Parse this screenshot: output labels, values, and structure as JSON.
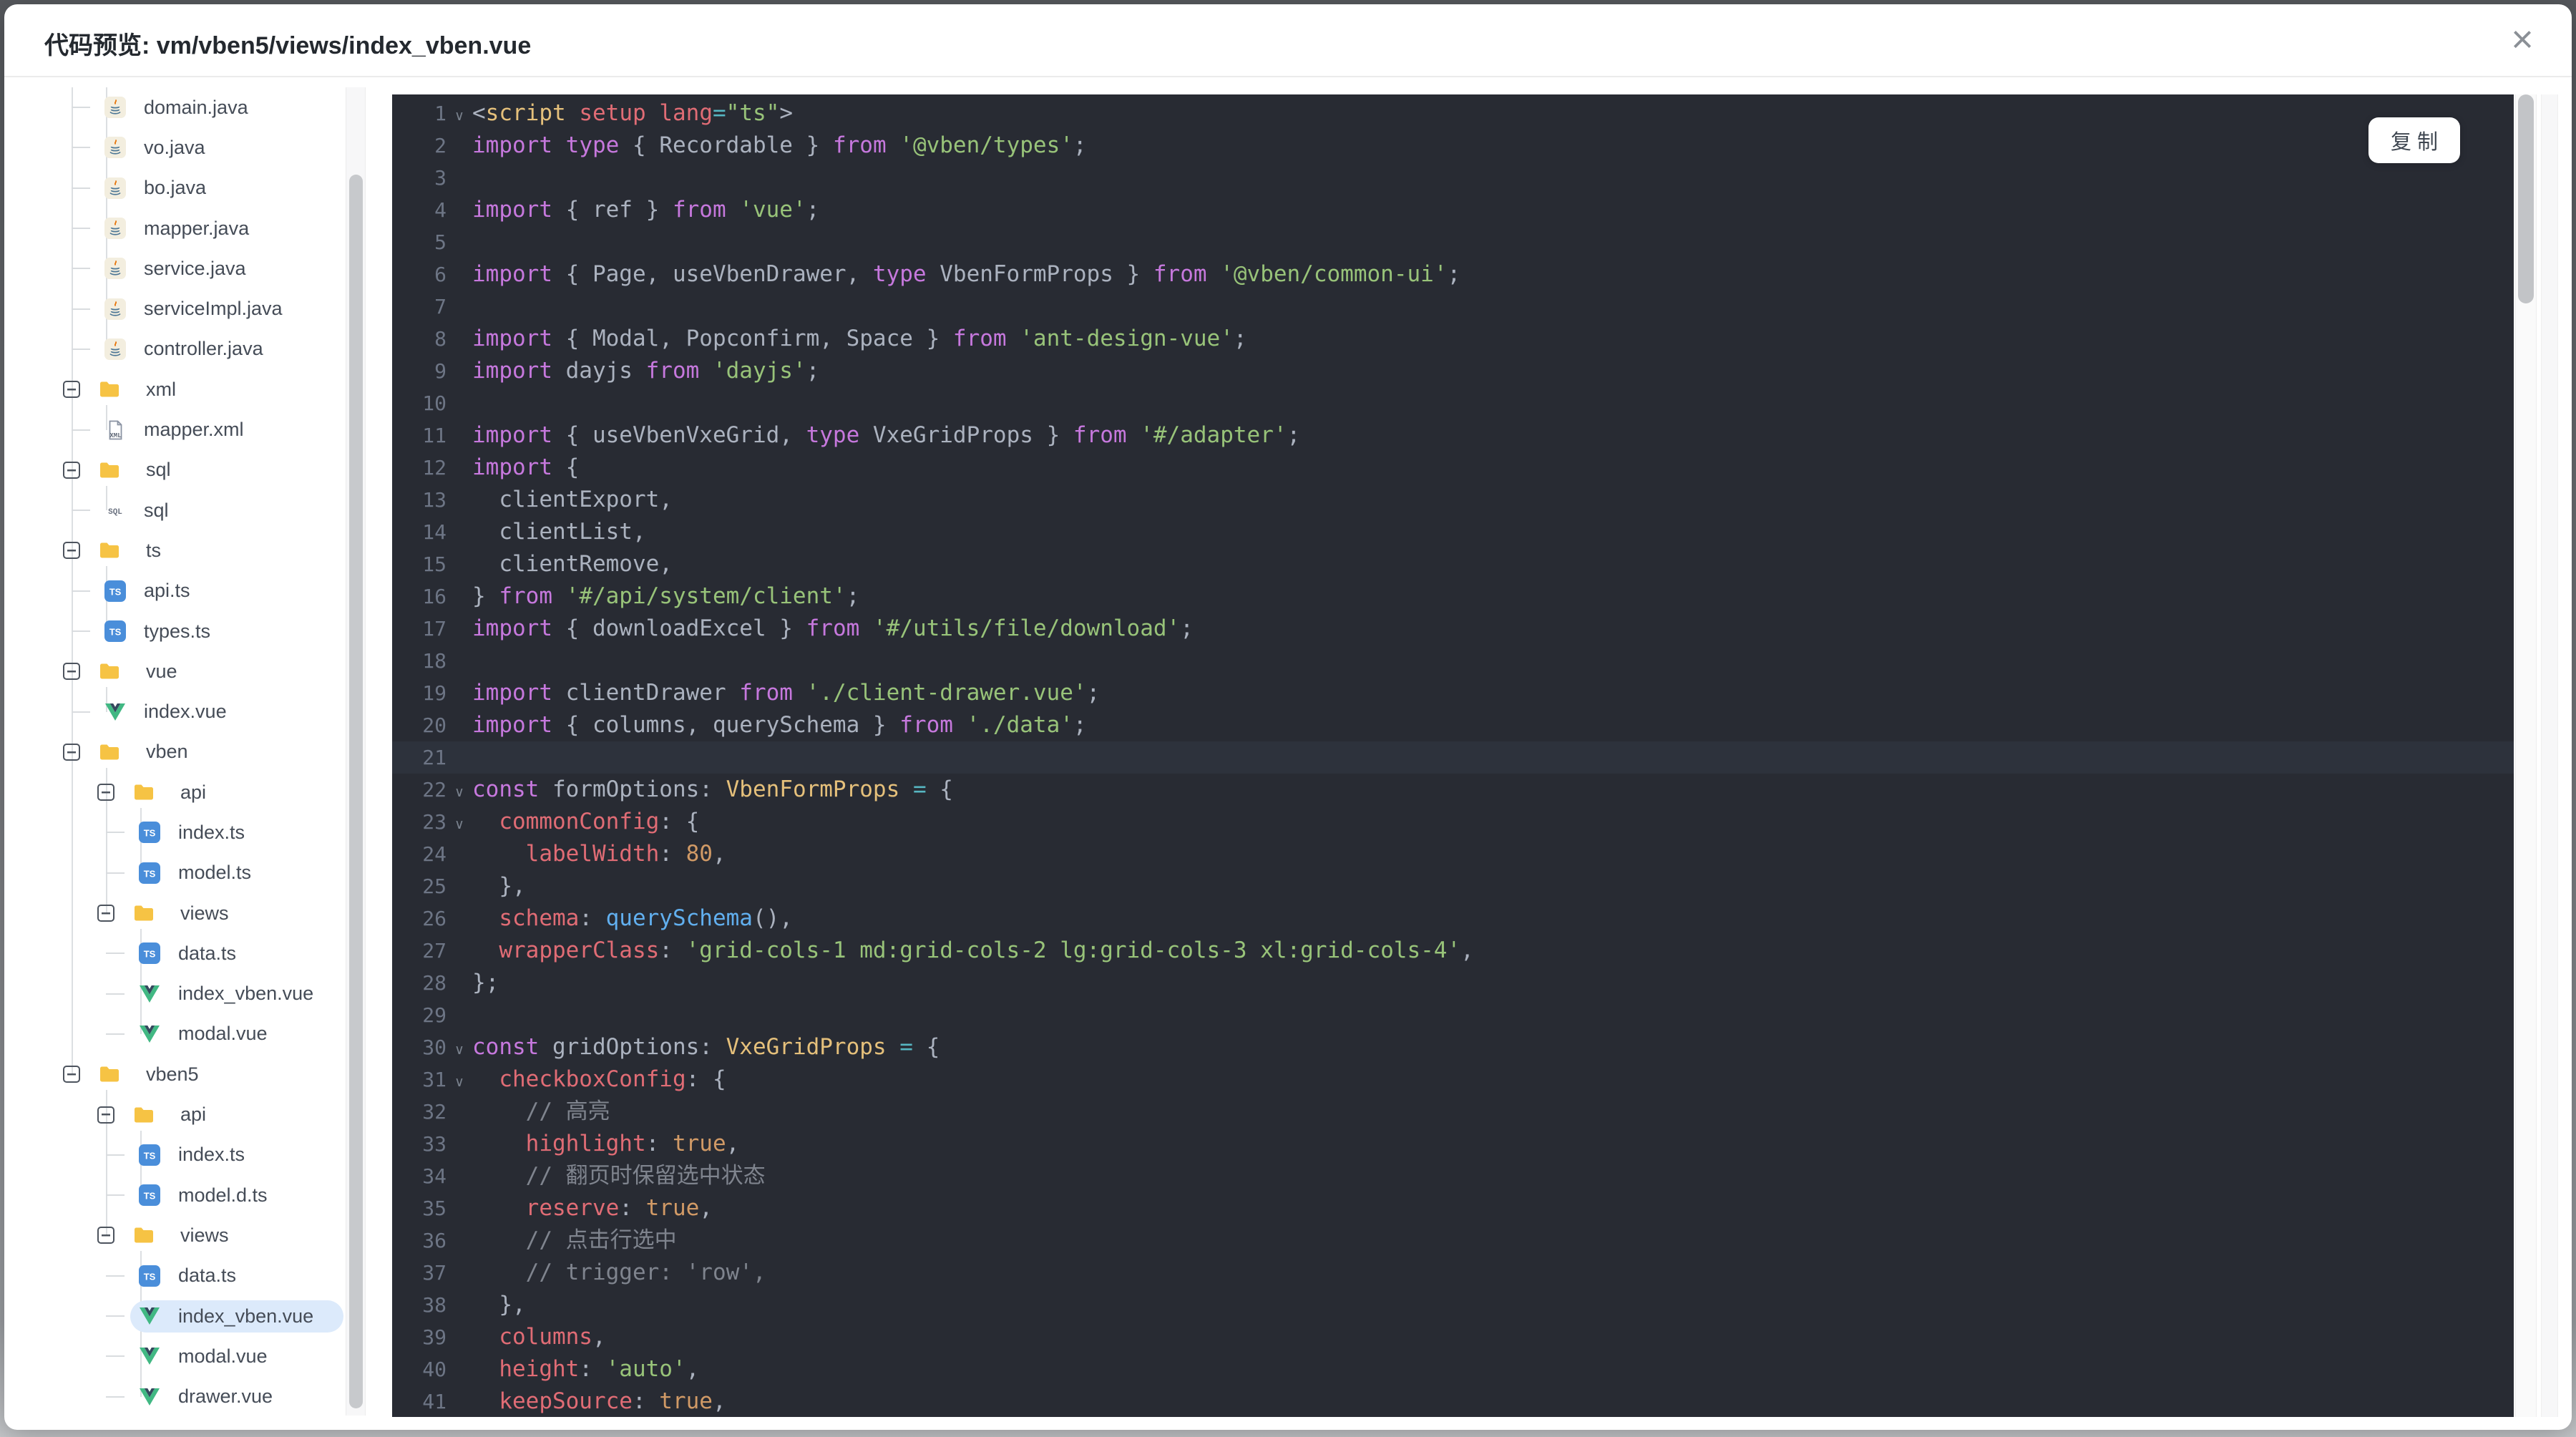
{
  "dialog": {
    "title": "代码预览: vm/vben5/views/index_vben.vue"
  },
  "icons": {
    "close": "×",
    "fold": "∨"
  },
  "colors": {
    "code_bg": "#282b33",
    "active_line": "#2d323c",
    "selected_item_bg": "#dceafb",
    "folder": "#F6C344",
    "ts_badge": "#4A8EDA",
    "vue_green": "#41B883",
    "vue_navy": "#35495E",
    "keyword": "#c678dd",
    "string": "#98c379",
    "property": "#e06c75",
    "type": "#e5c07b",
    "number": "#d19a66",
    "function": "#61afef",
    "operator": "#56b6c2",
    "comment": "#7f848e"
  },
  "code_viewer": {
    "copy_button": "复 制"
  },
  "file_tree": {
    "items": [
      {
        "label": "domain.java",
        "type": "java",
        "level": 2
      },
      {
        "label": "vo.java",
        "type": "java",
        "level": 2
      },
      {
        "label": "bo.java",
        "type": "java",
        "level": 2
      },
      {
        "label": "mapper.java",
        "type": "java",
        "level": 2
      },
      {
        "label": "service.java",
        "type": "java",
        "level": 2
      },
      {
        "label": "serviceImpl.java",
        "type": "java",
        "level": 2
      },
      {
        "label": "controller.java",
        "type": "java",
        "level": 2
      },
      {
        "label": "xml",
        "type": "folder",
        "level": 1
      },
      {
        "label": "mapper.xml",
        "type": "xml",
        "level": 2
      },
      {
        "label": "sql",
        "type": "folder",
        "level": 1
      },
      {
        "label": "sql",
        "type": "sql",
        "level": 2
      },
      {
        "label": "ts",
        "type": "folder",
        "level": 1
      },
      {
        "label": "api.ts",
        "type": "ts",
        "level": 2
      },
      {
        "label": "types.ts",
        "type": "ts",
        "level": 2
      },
      {
        "label": "vue",
        "type": "folder",
        "level": 1
      },
      {
        "label": "index.vue",
        "type": "vue",
        "level": 2
      },
      {
        "label": "vben",
        "type": "folder",
        "level": 1
      },
      {
        "label": "api",
        "type": "folder",
        "level": 2
      },
      {
        "label": "index.ts",
        "type": "ts",
        "level": 3
      },
      {
        "label": "model.ts",
        "type": "ts",
        "level": 3
      },
      {
        "label": "views",
        "type": "folder",
        "level": 2
      },
      {
        "label": "data.ts",
        "type": "ts",
        "level": 3
      },
      {
        "label": "index_vben.vue",
        "type": "vue",
        "level": 3
      },
      {
        "label": "modal.vue",
        "type": "vue",
        "level": 3
      },
      {
        "label": "vben5",
        "type": "folder",
        "level": 1
      },
      {
        "label": "api",
        "type": "folder",
        "level": 2
      },
      {
        "label": "index.ts",
        "type": "ts",
        "level": 3
      },
      {
        "label": "model.d.ts",
        "type": "ts",
        "level": 3
      },
      {
        "label": "views",
        "type": "folder",
        "level": 2
      },
      {
        "label": "data.ts",
        "type": "ts",
        "level": 3
      },
      {
        "label": "index_vben.vue",
        "type": "vue",
        "level": 3,
        "selected": true
      },
      {
        "label": "modal.vue",
        "type": "vue",
        "level": 3
      },
      {
        "label": "drawer.vue",
        "type": "vue",
        "level": 3
      }
    ]
  },
  "code": {
    "lines": [
      {
        "n": 1,
        "fold": true,
        "segs": [
          [
            "pun",
            "<"
          ],
          [
            "tag",
            "script"
          ],
          [
            "pun",
            " "
          ],
          [
            "attr",
            "setup"
          ],
          [
            "pun",
            " "
          ],
          [
            "attr",
            "lang"
          ],
          [
            "op",
            "="
          ],
          [
            "str",
            "\"ts\""
          ],
          [
            "pun",
            ">"
          ]
        ]
      },
      {
        "n": 2,
        "segs": [
          [
            "kw",
            "import"
          ],
          [
            "pun",
            " "
          ],
          [
            "kw",
            "type"
          ],
          [
            "pun",
            " { "
          ],
          [
            "var",
            "Recordable"
          ],
          [
            "pun",
            " } "
          ],
          [
            "kw",
            "from"
          ],
          [
            "pun",
            " "
          ],
          [
            "str",
            "'@vben/types'"
          ],
          [
            "pun",
            ";"
          ]
        ]
      },
      {
        "n": 3,
        "segs": []
      },
      {
        "n": 4,
        "segs": [
          [
            "kw",
            "import"
          ],
          [
            "pun",
            " { "
          ],
          [
            "var",
            "ref"
          ],
          [
            "pun",
            " } "
          ],
          [
            "kw",
            "from"
          ],
          [
            "pun",
            " "
          ],
          [
            "str",
            "'vue'"
          ],
          [
            "pun",
            ";"
          ]
        ]
      },
      {
        "n": 5,
        "segs": []
      },
      {
        "n": 6,
        "segs": [
          [
            "kw",
            "import"
          ],
          [
            "pun",
            " { "
          ],
          [
            "var",
            "Page, useVbenDrawer, "
          ],
          [
            "kw",
            "type"
          ],
          [
            "var",
            " VbenFormProps"
          ],
          [
            "pun",
            " } "
          ],
          [
            "kw",
            "from"
          ],
          [
            "pun",
            " "
          ],
          [
            "str",
            "'@vben/common-ui'"
          ],
          [
            "pun",
            ";"
          ]
        ]
      },
      {
        "n": 7,
        "segs": []
      },
      {
        "n": 8,
        "segs": [
          [
            "kw",
            "import"
          ],
          [
            "pun",
            " { "
          ],
          [
            "var",
            "Modal, Popconfirm, Space"
          ],
          [
            "pun",
            " } "
          ],
          [
            "kw",
            "from"
          ],
          [
            "pun",
            " "
          ],
          [
            "str",
            "'ant-design-vue'"
          ],
          [
            "pun",
            ";"
          ]
        ]
      },
      {
        "n": 9,
        "segs": [
          [
            "kw",
            "import"
          ],
          [
            "var",
            " dayjs "
          ],
          [
            "kw",
            "from"
          ],
          [
            "pun",
            " "
          ],
          [
            "str",
            "'dayjs'"
          ],
          [
            "pun",
            ";"
          ]
        ]
      },
      {
        "n": 10,
        "segs": []
      },
      {
        "n": 11,
        "segs": [
          [
            "kw",
            "import"
          ],
          [
            "pun",
            " { "
          ],
          [
            "var",
            "useVbenVxeGrid, "
          ],
          [
            "kw",
            "type"
          ],
          [
            "var",
            " VxeGridProps"
          ],
          [
            "pun",
            " } "
          ],
          [
            "kw",
            "from"
          ],
          [
            "pun",
            " "
          ],
          [
            "str",
            "'#/adapter'"
          ],
          [
            "pun",
            ";"
          ]
        ]
      },
      {
        "n": 12,
        "segs": [
          [
            "kw",
            "import"
          ],
          [
            "pun",
            " {"
          ]
        ]
      },
      {
        "n": 13,
        "segs": [
          [
            "var",
            "  clientExport,"
          ]
        ]
      },
      {
        "n": 14,
        "segs": [
          [
            "var",
            "  clientList,"
          ]
        ]
      },
      {
        "n": 15,
        "segs": [
          [
            "var",
            "  clientRemove,"
          ]
        ]
      },
      {
        "n": 16,
        "segs": [
          [
            "pun",
            "} "
          ],
          [
            "kw",
            "from"
          ],
          [
            "pun",
            " "
          ],
          [
            "str",
            "'#/api/system/client'"
          ],
          [
            "pun",
            ";"
          ]
        ]
      },
      {
        "n": 17,
        "segs": [
          [
            "kw",
            "import"
          ],
          [
            "pun",
            " { "
          ],
          [
            "var",
            "downloadExcel"
          ],
          [
            "pun",
            " } "
          ],
          [
            "kw",
            "from"
          ],
          [
            "pun",
            " "
          ],
          [
            "str",
            "'#/utils/file/download'"
          ],
          [
            "pun",
            ";"
          ]
        ]
      },
      {
        "n": 18,
        "segs": []
      },
      {
        "n": 19,
        "segs": [
          [
            "kw",
            "import"
          ],
          [
            "var",
            " clientDrawer "
          ],
          [
            "kw",
            "from"
          ],
          [
            "pun",
            " "
          ],
          [
            "str",
            "'./client-drawer.vue'"
          ],
          [
            "pun",
            ";"
          ]
        ]
      },
      {
        "n": 20,
        "segs": [
          [
            "kw",
            "import"
          ],
          [
            "pun",
            " { "
          ],
          [
            "var",
            "columns, querySchema"
          ],
          [
            "pun",
            " } "
          ],
          [
            "kw",
            "from"
          ],
          [
            "pun",
            " "
          ],
          [
            "str",
            "'./data'"
          ],
          [
            "pun",
            ";"
          ]
        ]
      },
      {
        "n": 21,
        "active": true,
        "segs": []
      },
      {
        "n": 22,
        "fold": true,
        "segs": [
          [
            "kw",
            "const"
          ],
          [
            "var",
            " formOptions"
          ],
          [
            "pun",
            ": "
          ],
          [
            "tag",
            "VbenFormProps"
          ],
          [
            "pun",
            " "
          ],
          [
            "op",
            "="
          ],
          [
            "pun",
            " {"
          ]
        ]
      },
      {
        "n": 23,
        "fold": true,
        "segs": [
          [
            "prop",
            "  commonConfig"
          ],
          [
            "pun",
            ": {"
          ]
        ]
      },
      {
        "n": 24,
        "segs": [
          [
            "prop",
            "    labelWidth"
          ],
          [
            "pun",
            ": "
          ],
          [
            "num",
            "80"
          ],
          [
            "pun",
            ","
          ]
        ]
      },
      {
        "n": 25,
        "segs": [
          [
            "pun",
            "  },"
          ]
        ]
      },
      {
        "n": 26,
        "segs": [
          [
            "prop",
            "  schema"
          ],
          [
            "pun",
            ": "
          ],
          [
            "fn",
            "querySchema"
          ],
          [
            "pun",
            "(),"
          ]
        ]
      },
      {
        "n": 27,
        "segs": [
          [
            "prop",
            "  wrapperClass"
          ],
          [
            "pun",
            ": "
          ],
          [
            "str",
            "'grid-cols-1 md:grid-cols-2 lg:grid-cols-3 xl:grid-cols-4'"
          ],
          [
            "pun",
            ","
          ]
        ]
      },
      {
        "n": 28,
        "segs": [
          [
            "pun",
            "};"
          ]
        ]
      },
      {
        "n": 29,
        "segs": []
      },
      {
        "n": 30,
        "fold": true,
        "segs": [
          [
            "kw",
            "const"
          ],
          [
            "var",
            " gridOptions"
          ],
          [
            "pun",
            ": "
          ],
          [
            "tag",
            "VxeGridProps"
          ],
          [
            "pun",
            " "
          ],
          [
            "op",
            "="
          ],
          [
            "pun",
            " {"
          ]
        ]
      },
      {
        "n": 31,
        "fold": true,
        "segs": [
          [
            "prop",
            "  checkboxConfig"
          ],
          [
            "pun",
            ": {"
          ]
        ]
      },
      {
        "n": 32,
        "segs": [
          [
            "com",
            "    // 高亮"
          ]
        ]
      },
      {
        "n": 33,
        "segs": [
          [
            "prop",
            "    highlight"
          ],
          [
            "pun",
            ": "
          ],
          [
            "num",
            "true"
          ],
          [
            "pun",
            ","
          ]
        ]
      },
      {
        "n": 34,
        "segs": [
          [
            "com",
            "    // 翻页时保留选中状态"
          ]
        ]
      },
      {
        "n": 35,
        "segs": [
          [
            "prop",
            "    reserve"
          ],
          [
            "pun",
            ": "
          ],
          [
            "num",
            "true"
          ],
          [
            "pun",
            ","
          ]
        ]
      },
      {
        "n": 36,
        "segs": [
          [
            "com",
            "    // 点击行选中"
          ]
        ]
      },
      {
        "n": 37,
        "segs": [
          [
            "com",
            "    // trigger: 'row',"
          ]
        ]
      },
      {
        "n": 38,
        "segs": [
          [
            "pun",
            "  },"
          ]
        ]
      },
      {
        "n": 39,
        "segs": [
          [
            "prop",
            "  columns"
          ],
          [
            "pun",
            ","
          ]
        ]
      },
      {
        "n": 40,
        "segs": [
          [
            "prop",
            "  height"
          ],
          [
            "pun",
            ": "
          ],
          [
            "str",
            "'auto'"
          ],
          [
            "pun",
            ","
          ]
        ]
      },
      {
        "n": 41,
        "segs": [
          [
            "prop",
            "  keepSource"
          ],
          [
            "pun",
            ": "
          ],
          [
            "num",
            "true"
          ],
          [
            "pun",
            ","
          ]
        ]
      }
    ]
  }
}
